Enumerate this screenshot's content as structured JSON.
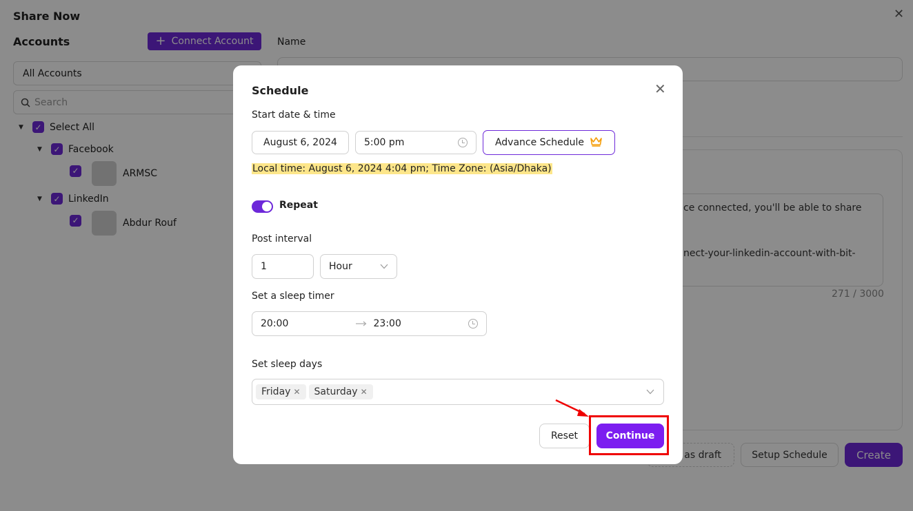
{
  "page": {
    "title": "Share Now",
    "close_icon": "✕",
    "accounts_label": "Accounts",
    "connect_button": "Connect Account",
    "account_filter": "All Accounts",
    "search_placeholder": "Search",
    "name_label": "Name",
    "tree": {
      "select_all": "Select All",
      "groups": [
        {
          "label": "Facebook",
          "accounts": [
            "ARMSC"
          ]
        },
        {
          "label": "LinkedIn",
          "accounts": [
            "Abdur Rouf"
          ]
        }
      ]
    },
    "content_preview": {
      "line1": "ce connected, you'll be able to share",
      "line2": "nect-your-linkedin-account-with-bit-"
    },
    "char_count": "271 / 3000",
    "draft_button": "as draft",
    "setup_schedule_button": "Setup Schedule",
    "create_button": "Create"
  },
  "modal": {
    "title": "Schedule",
    "start_label": "Start date & time",
    "date_value": "August 6, 2024",
    "time_value": "5:00 pm",
    "advance_schedule": "Advance Schedule",
    "local_time": "Local time: August 6, 2024 4:04 pm; Time Zone: (Asia/Dhaka)",
    "repeat_label": "Repeat",
    "repeat_on": true,
    "post_interval_label": "Post interval",
    "interval_value": "1",
    "interval_unit": "Hour",
    "sleep_timer_label": "Set a sleep timer",
    "sleep_start": "20:00",
    "sleep_end": "23:00",
    "sleep_days_label": "Set sleep days",
    "sleep_days": [
      "Friday",
      "Saturday"
    ],
    "reset_button": "Reset",
    "continue_button": "Continue"
  },
  "colors": {
    "accent": "#6d28d9",
    "continue": "#7c1ef0",
    "highlight": "#ef0000",
    "local_time_bg": "#fde68a"
  }
}
